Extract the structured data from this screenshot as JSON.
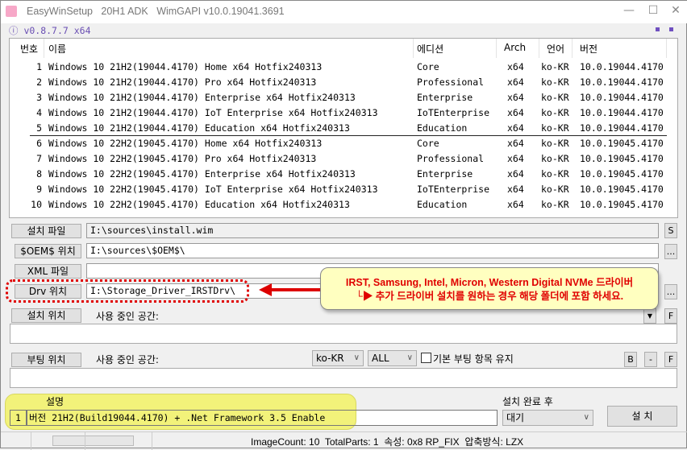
{
  "window": {
    "title": "EasyWinSetup   20H1 ADK   WimGAPI v10.0.19041.3691",
    "version": "v0.8.7.7 x64",
    "info_icon": "ⓘ"
  },
  "list": {
    "headers": [
      "번호",
      "이름",
      "에디션",
      "Arch",
      "언어",
      "버전"
    ],
    "rows": [
      [
        "1",
        "Windows 10 21H2(19044.4170) Home x64 Hotfix240313",
        "Core",
        "x64",
        "ko-KR",
        "10.0.19044.4170"
      ],
      [
        "2",
        "Windows 10 21H2(19044.4170) Pro x64 Hotfix240313",
        "Professional",
        "x64",
        "ko-KR",
        "10.0.19044.4170"
      ],
      [
        "3",
        "Windows 10 21H2(19044.4170) Enterprise x64 Hotfix240313",
        "Enterprise",
        "x64",
        "ko-KR",
        "10.0.19044.4170"
      ],
      [
        "4",
        "Windows 10 21H2(19044.4170) IoT Enterprise x64 Hotfix240313",
        "IoTEnterprise",
        "x64",
        "ko-KR",
        "10.0.19044.4170"
      ],
      [
        "5",
        "Windows 10 21H2(19044.4170) Education x64 Hotfix240313",
        "Education",
        "x64",
        "ko-KR",
        "10.0.19044.4170"
      ],
      [
        "6",
        "Windows 10 22H2(19045.4170) Home x64 Hotfix240313",
        "Core",
        "x64",
        "ko-KR",
        "10.0.19045.4170"
      ],
      [
        "7",
        "Windows 10 22H2(19045.4170) Pro x64 Hotfix240313",
        "Professional",
        "x64",
        "ko-KR",
        "10.0.19045.4170"
      ],
      [
        "8",
        "Windows 10 22H2(19045.4170) Enterprise x64 Hotfix240313",
        "Enterprise",
        "x64",
        "ko-KR",
        "10.0.19045.4170"
      ],
      [
        "9",
        "Windows 10 22H2(19045.4170) IoT Enterprise x64 Hotfix240313",
        "IoTEnterprise",
        "x64",
        "ko-KR",
        "10.0.19045.4170"
      ],
      [
        "10",
        "Windows 10 22H2(19045.4170) Education x64 Hotfix240313",
        "Education",
        "x64",
        "ko-KR",
        "10.0.19045.4170"
      ]
    ]
  },
  "form": {
    "install_file": {
      "label": "설치 파일",
      "value": "I:\\sources\\install.wim",
      "side": "S"
    },
    "oem": {
      "label": "$OEM$ 위치",
      "value": "I:\\sources\\$OEM$\\",
      "side": "..."
    },
    "xml": {
      "label": "XML 파일",
      "value": ""
    },
    "drv": {
      "label": "Drv 위치",
      "value": "I:\\Storage_Driver_IRSTDrv\\",
      "side": "..."
    },
    "install_loc": {
      "label": "설치 위치",
      "used": "사용 중인 공간:",
      "side": "F"
    },
    "boot_loc": {
      "label": "부팅 위치",
      "used": "사용 중인 공간:",
      "lang": "ko-KR",
      "filter": "ALL",
      "keep_label": "기본 부팅 항목 유지",
      "keep_checked": false,
      "b": "B",
      "minus": "-",
      "f": "F"
    }
  },
  "callout": {
    "line1": "IRST, Samsung, Intel, Micron, Western Digital NVMe 드라이버",
    "line2": "└▶ 추가 드라이버 설치를 원하는 경우 해당 폴더에 포함 하세요."
  },
  "bottom": {
    "desc_header": "설명",
    "desc_num": "1",
    "desc_text": "버전 21H2(Build19044.4170) + .Net Framework 3.5 Enable",
    "after_label": "설치 완료 후",
    "after_value": "대기",
    "install_button": "설 치"
  },
  "status": {
    "text": "ImageCount: 10  TotalParts: 1  속성: 0x8 RP_FIX  압축방식: LZX"
  },
  "colors": {
    "accent": "#6a4fb3",
    "callout_bg": "#ffffc0",
    "callout_text": "#e00000",
    "highlight": "#f2f27a"
  }
}
